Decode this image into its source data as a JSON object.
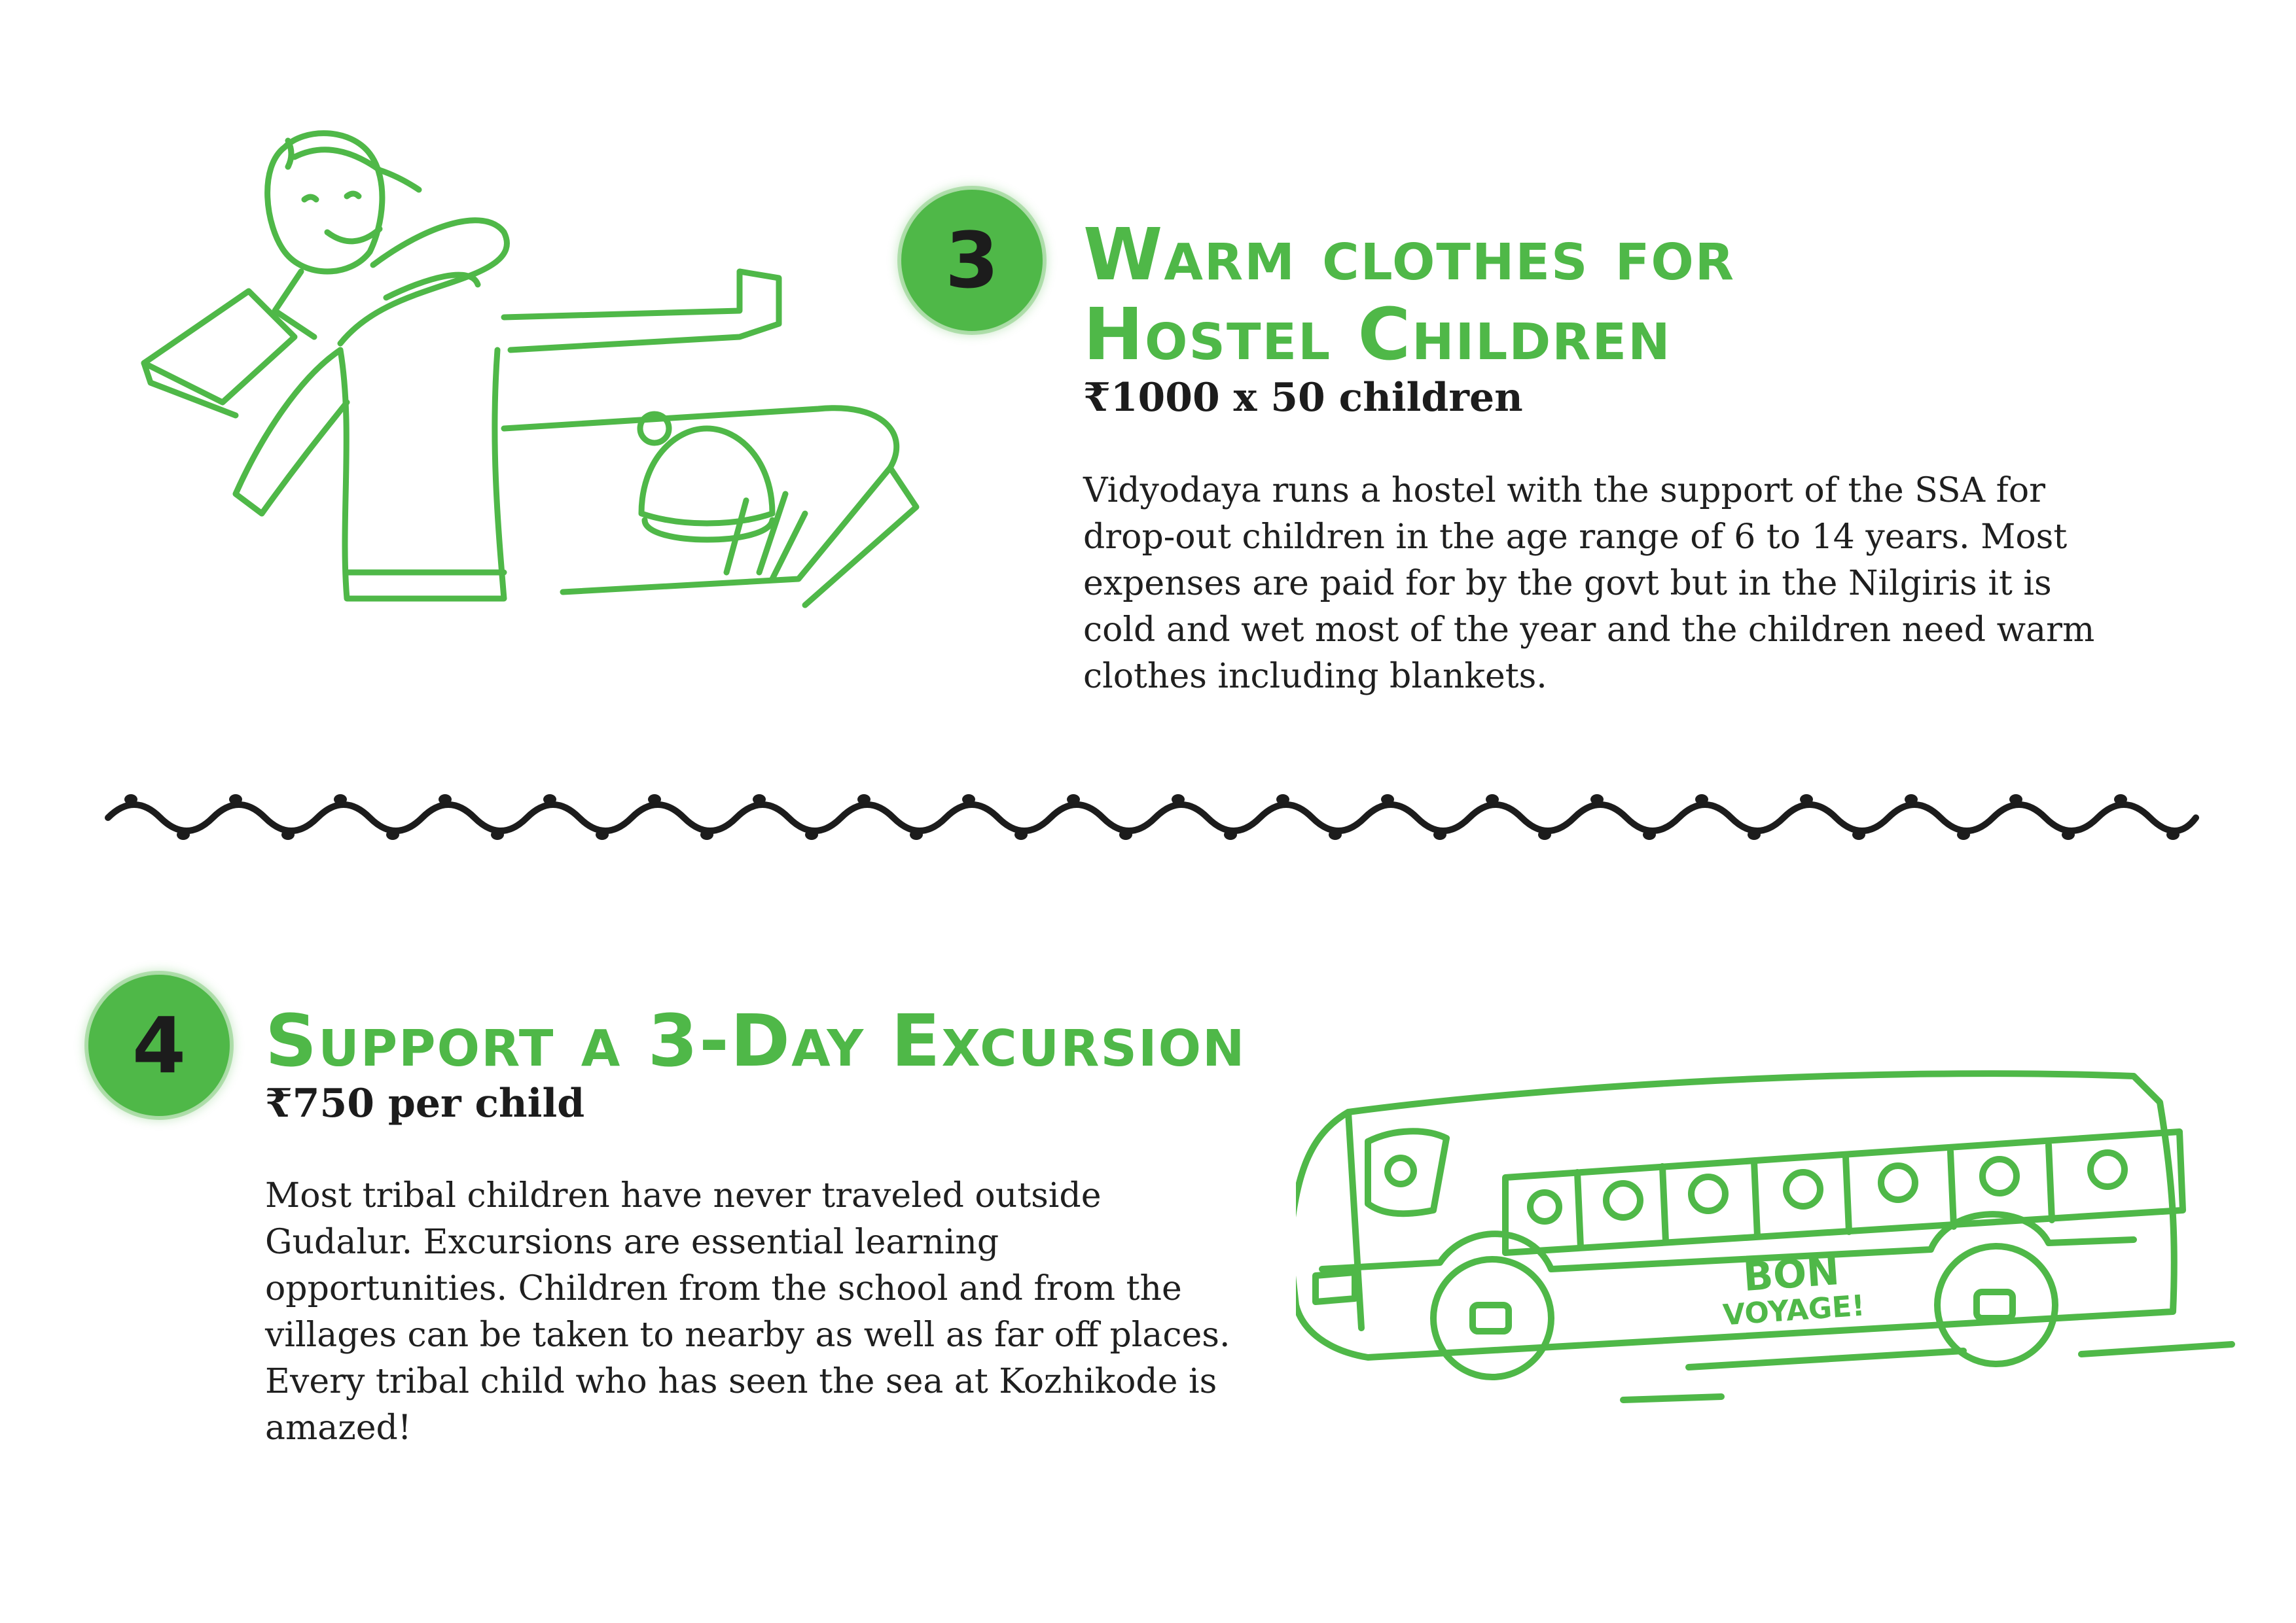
{
  "sections": [
    {
      "number": "3",
      "title_line1": "Warm clothes for",
      "title_line2": "Hostel Children",
      "price": "₹1000 x 50 children",
      "body_lines": [
        "Vidyodaya runs a hostel with the support of the SSA for",
        "drop-out children in the age range of 6 to 14 years. Most",
        "expenses are paid for by the govt but in the Nilgiris it is",
        "cold and wet most of the year and the children need warm",
        "clothes including blankets."
      ]
    },
    {
      "number": "4",
      "title_line1": "Support a 3-Day Excursion",
      "price": "₹750 per child",
      "body_lines": [
        "Most tribal children have never traveled outside",
        "Gudalur. Excursions are essential learning",
        "opportunities. Children from the school and from the",
        "villages can be taken to nearby as well as far off places.",
        "Every tribal child who has seen the sea at Kozhikode is",
        "amazed!"
      ]
    }
  ],
  "bus_sign": {
    "line1": "BON",
    "line2": "VOYAGE!"
  },
  "colors": {
    "accent": "#4fb848",
    "text": "#1f1f1f"
  },
  "illustrations": [
    "boy-with-warm-clothes-illustration",
    "school-bus-illustration"
  ]
}
